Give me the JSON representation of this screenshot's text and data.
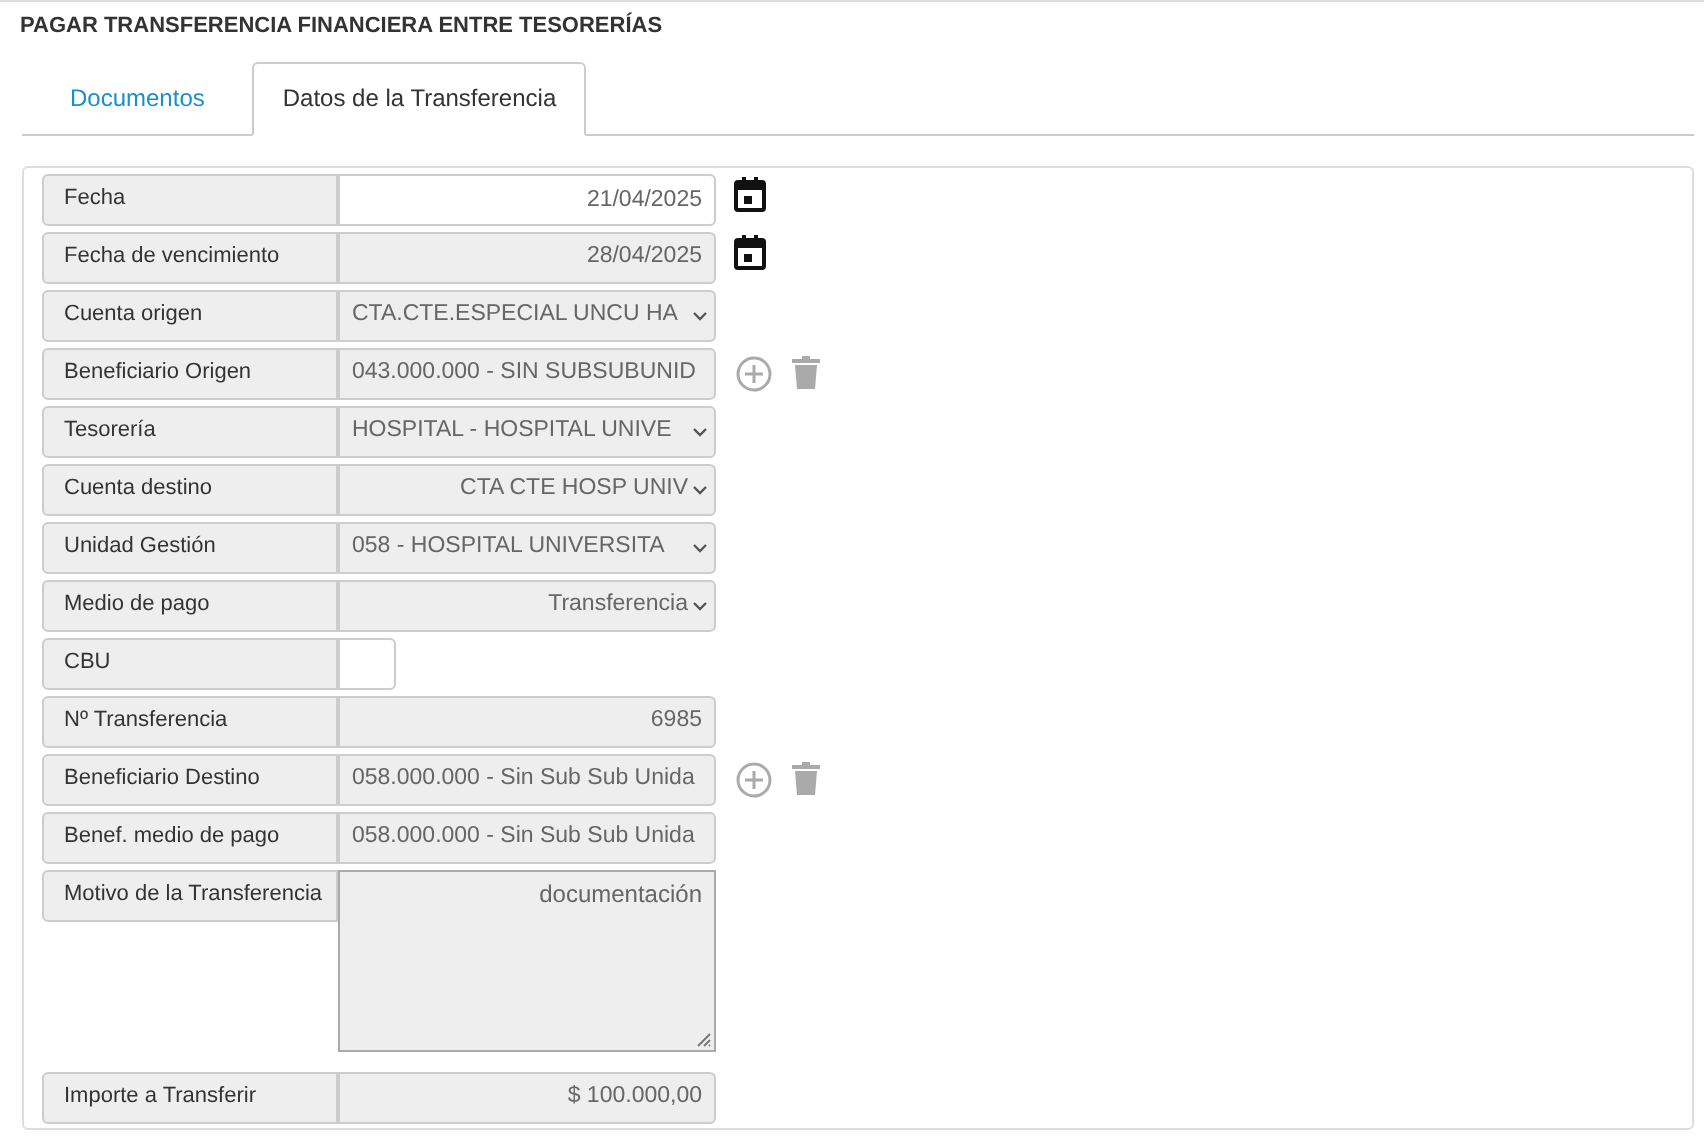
{
  "title": "PAGAR TRANSFERENCIA FINANCIERA ENTRE TESORERÍAS",
  "tabs": [
    {
      "label": "Documentos",
      "selected": false
    },
    {
      "label": "Datos de la Transferencia",
      "selected": true
    }
  ],
  "fields": [
    {
      "label": "Fecha",
      "kind": "input",
      "value": "21/04/2025",
      "right_aligned": true,
      "action": {
        "kind": "calendar"
      }
    },
    {
      "label": "Fecha de vencimiento",
      "kind": "readonly",
      "value": "28/04/2025",
      "right_aligned": true,
      "action": {
        "kind": "calendar"
      }
    },
    {
      "label": "Cuenta origen",
      "kind": "select",
      "value": "CTA.CTE.ESPECIAL UNCU HA",
      "right_aligned": false
    },
    {
      "label": "Beneficiario Origen",
      "kind": "readonly",
      "value": "043.000.000 - SIN SUBSUBUNID",
      "right_aligned": false,
      "action": {
        "kind": "add-remove"
      }
    },
    {
      "label": "Tesorería",
      "kind": "select",
      "value": "HOSPITAL - HOSPITAL UNIVE",
      "right_aligned": false
    },
    {
      "label": "Cuenta destino",
      "kind": "select",
      "value": "CTA CTE HOSP UNIV",
      "right_aligned": true
    },
    {
      "label": "Unidad Gestión",
      "kind": "select",
      "value": "058 - HOSPITAL UNIVERSITA",
      "right_aligned": false
    },
    {
      "label": "Medio de pago",
      "kind": "select",
      "value": "Transferencia",
      "right_aligned": true
    },
    {
      "label": "CBU",
      "kind": "short-input"
    },
    {
      "label": "Nº Transferencia",
      "kind": "readonly",
      "value": "6985",
      "right_aligned": true
    },
    {
      "label": "Beneficiario Destino",
      "kind": "readonly",
      "value": "058.000.000 - Sin Sub Sub Unida",
      "right_aligned": false,
      "action": {
        "kind": "add-remove"
      }
    },
    {
      "label": "Benef. medio de pago",
      "kind": "readonly",
      "value": "058.000.000 - Sin Sub Sub Unida",
      "right_aligned": false
    },
    {
      "label": "Motivo de la Transferencia",
      "kind": "textarea",
      "value": "documentación",
      "right_aligned": true
    },
    {
      "label": "Importe a Transferir",
      "kind": "readonly",
      "value": "$ 100.000,00",
      "right_aligned": true
    }
  ]
}
